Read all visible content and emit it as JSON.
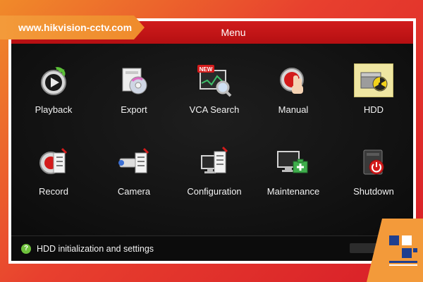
{
  "banner": {
    "url": "www.hikvision-cctv.com"
  },
  "window": {
    "title": "Menu"
  },
  "menu": {
    "items": [
      {
        "label": "Playback",
        "icon": "playback-icon"
      },
      {
        "label": "Export",
        "icon": "export-icon"
      },
      {
        "label": "VCA Search",
        "icon": "vca-search-icon",
        "badge": "NEW"
      },
      {
        "label": "Manual",
        "icon": "manual-icon"
      },
      {
        "label": "HDD",
        "icon": "hdd-icon"
      },
      {
        "label": "Record",
        "icon": "record-icon"
      },
      {
        "label": "Camera",
        "icon": "camera-icon"
      },
      {
        "label": "Configuration",
        "icon": "configuration-icon"
      },
      {
        "label": "Maintenance",
        "icon": "maintenance-icon"
      },
      {
        "label": "Shutdown",
        "icon": "shutdown-icon"
      }
    ]
  },
  "status": {
    "text": "HDD initialization and settings",
    "icon": "help-icon"
  },
  "colors": {
    "titlebar": "#c4161a",
    "accent_orange": "#f39a3a",
    "screen_bg": "#111111",
    "status_icon": "#6ec23c"
  }
}
